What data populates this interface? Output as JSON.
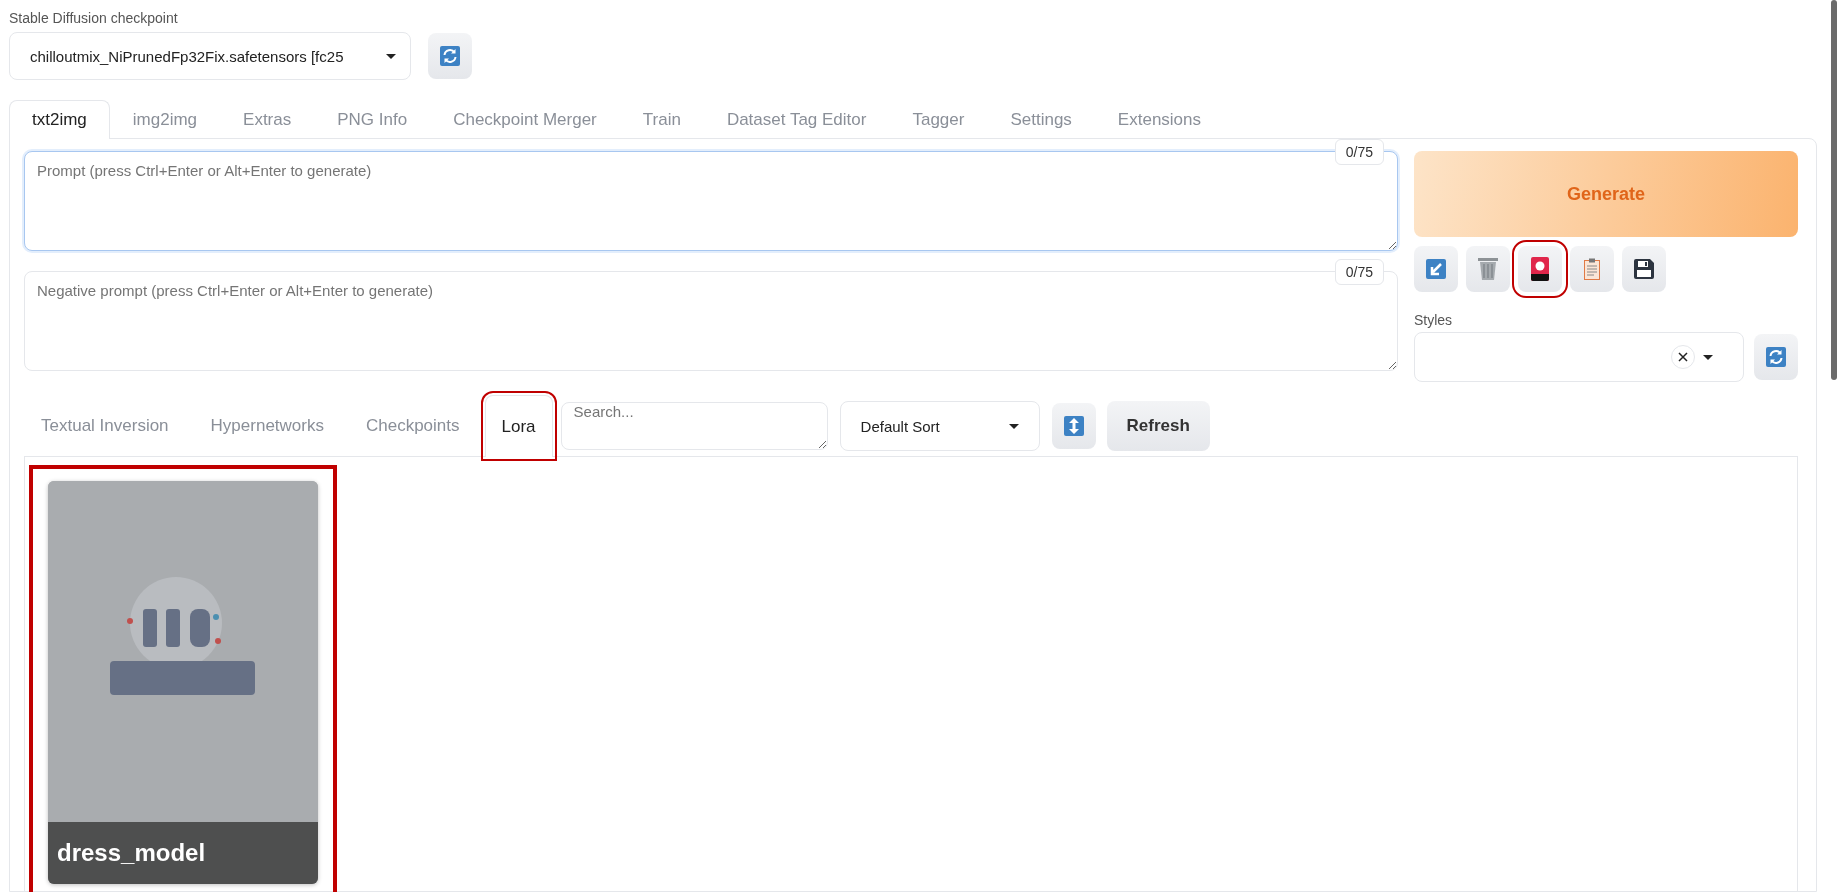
{
  "checkpoint": {
    "label": "Stable Diffusion checkpoint",
    "value": "chilloutmix_NiPrunedFp32Fix.safetensors [fc25"
  },
  "tabs": [
    {
      "label": "txt2img",
      "selected": true
    },
    {
      "label": "img2img",
      "selected": false
    },
    {
      "label": "Extras",
      "selected": false
    },
    {
      "label": "PNG Info",
      "selected": false
    },
    {
      "label": "Checkpoint Merger",
      "selected": false
    },
    {
      "label": "Train",
      "selected": false
    },
    {
      "label": "Dataset Tag Editor",
      "selected": false
    },
    {
      "label": "Tagger",
      "selected": false
    },
    {
      "label": "Settings",
      "selected": false
    },
    {
      "label": "Extensions",
      "selected": false
    }
  ],
  "prompt": {
    "placeholder": "Prompt (press Ctrl+Enter or Alt+Enter to generate)",
    "counter": "0/75"
  },
  "negative_prompt": {
    "placeholder": "Negative prompt (press Ctrl+Enter or Alt+Enter to generate)",
    "counter": "0/75"
  },
  "generate": {
    "label": "Generate"
  },
  "tool_buttons": [
    {
      "kind": "paste",
      "highlighted": false
    },
    {
      "kind": "trash",
      "highlighted": false
    },
    {
      "kind": "card",
      "highlighted": true
    },
    {
      "kind": "clipboard",
      "highlighted": false
    },
    {
      "kind": "save",
      "highlighted": false
    }
  ],
  "styles": {
    "label": "Styles"
  },
  "extra_tabs": [
    {
      "label": "Textual Inversion",
      "selected": false,
      "highlighted": false
    },
    {
      "label": "Hypernetworks",
      "selected": false,
      "highlighted": false
    },
    {
      "label": "Checkpoints",
      "selected": false,
      "highlighted": false
    },
    {
      "label": "Lora",
      "selected": true,
      "highlighted": true
    }
  ],
  "search": {
    "placeholder": "Search..."
  },
  "sort": {
    "value": "Default Sort"
  },
  "refresh": {
    "label": "Refresh"
  },
  "cards": [
    {
      "name": "dress_model",
      "kind": "picture",
      "highlighted": true
    }
  ]
}
